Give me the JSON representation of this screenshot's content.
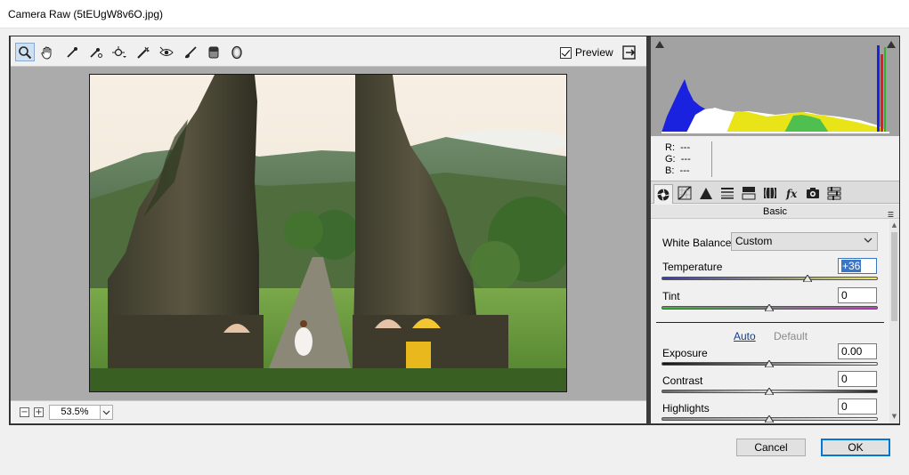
{
  "window": {
    "title": "Camera Raw (5tEUgW8v6O.jpg)"
  },
  "toolbar": {
    "tools": [
      {
        "name": "zoom-tool",
        "icon": "magnifier-icon",
        "active": true
      },
      {
        "name": "hand-tool",
        "icon": "hand-icon"
      },
      {
        "name": "white-balance-tool",
        "icon": "eyedropper-icon"
      },
      {
        "name": "color-sampler-tool",
        "icon": "color-sampler-icon"
      },
      {
        "name": "targeted-adjustment-tool",
        "icon": "target-adjust-icon"
      },
      {
        "name": "spot-removal-tool",
        "icon": "spot-removal-icon"
      },
      {
        "name": "red-eye-tool",
        "icon": "red-eye-icon"
      },
      {
        "name": "adjustment-brush-tool",
        "icon": "brush-icon"
      },
      {
        "name": "graduated-filter-tool",
        "icon": "graduated-filter-icon"
      },
      {
        "name": "radial-filter-tool",
        "icon": "radial-filter-icon"
      }
    ],
    "preview_label": "Preview",
    "preview_checked": true
  },
  "statusbar": {
    "zoom_value": "53.5%"
  },
  "readout": {
    "r_label": "R:",
    "r_value": "---",
    "g_label": "G:",
    "g_value": "---",
    "b_label": "B:",
    "b_value": "---"
  },
  "panel": {
    "title": "Basic",
    "tabs": [
      "basic-tab",
      "tone-curve-tab",
      "detail-tab",
      "hsl-tab",
      "split-toning-tab",
      "lens-corrections-tab",
      "effects-tab",
      "camera-calibration-tab",
      "presets-tab"
    ]
  },
  "basic": {
    "white_balance_label": "White Balance:",
    "white_balance_value": "Custom",
    "temperature_label": "Temperature",
    "temperature_value": "+36",
    "tint_label": "Tint",
    "tint_value": "0",
    "auto_label": "Auto",
    "default_label": "Default",
    "exposure_label": "Exposure",
    "exposure_value": "0.00",
    "contrast_label": "Contrast",
    "contrast_value": "0",
    "highlights_label": "Highlights",
    "highlights_value": "0"
  },
  "buttons": {
    "cancel": "Cancel",
    "ok": "OK"
  }
}
